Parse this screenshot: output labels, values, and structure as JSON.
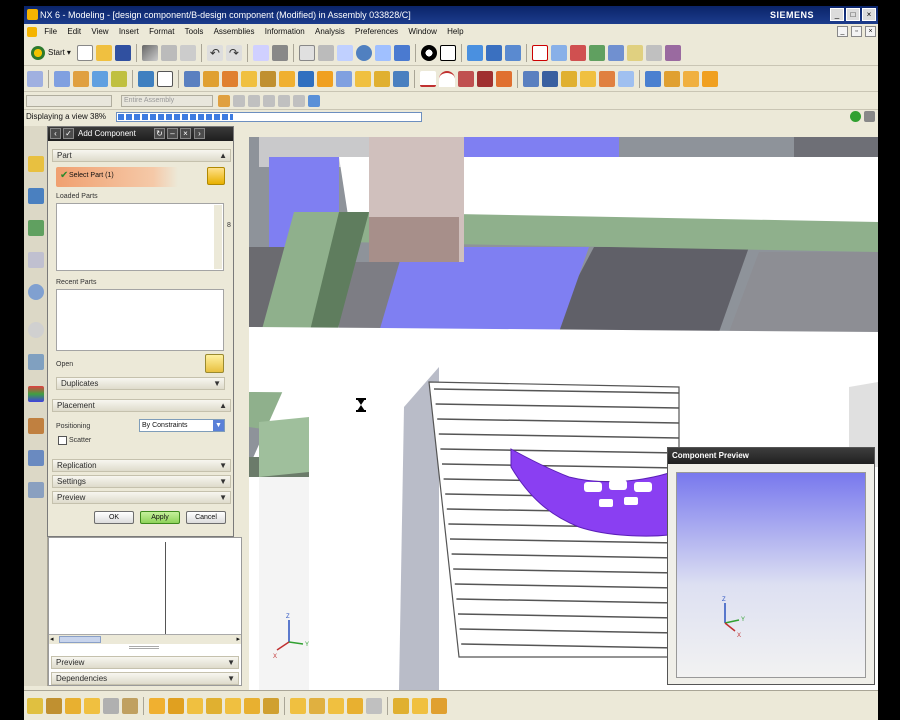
{
  "window": {
    "title": "NX 6 - Modeling - [design component/B-design component (Modified)  in Assembly 033828/C]",
    "brand": "SIEMENS",
    "controls": [
      "_",
      "□",
      "×"
    ]
  },
  "menubar": {
    "items": [
      "File",
      "Edit",
      "View",
      "Insert",
      "Format",
      "Tools",
      "Assemblies",
      "Information",
      "Analysis",
      "Preferences",
      "Window",
      "Help"
    ]
  },
  "toolbar": {
    "start_label": "Start",
    "filter_placeholder": "Entire Assembly"
  },
  "status": {
    "message": "Displaying a view 38%",
    "progress": 0.38
  },
  "dialog": {
    "title": "Add Component",
    "sections": {
      "part": "Part",
      "placement": "Placement",
      "replication": "Replication",
      "settings": "Settings",
      "preview": "Preview",
      "duplicates": "Duplicates"
    },
    "select_part": "Select Part (1)",
    "loaded_parts": "Loaded Parts",
    "recent_parts": "Recent Parts",
    "open": "Open",
    "positioning_label": "Positioning",
    "positioning_value": "By Constraints",
    "scatter_label": "Scatter",
    "ok": "OK",
    "apply": "Apply",
    "cancel": "Cancel"
  },
  "lower_panel": {
    "preview": "Preview",
    "dependencies": "Dependencies"
  },
  "component_preview": {
    "title": "Component Preview",
    "axes": [
      "Z",
      "Y",
      "X"
    ]
  },
  "viewport": {
    "axes": [
      "Z",
      "Y",
      "X"
    ]
  },
  "colors": {
    "title_bar": "#0a246a",
    "select_highlight": "#f0a070",
    "model_purple": "#8a3ff2",
    "floor_blue": "#7f7ff2",
    "beam_green": "#8fb08c",
    "apply_green": "#8ed35a"
  }
}
